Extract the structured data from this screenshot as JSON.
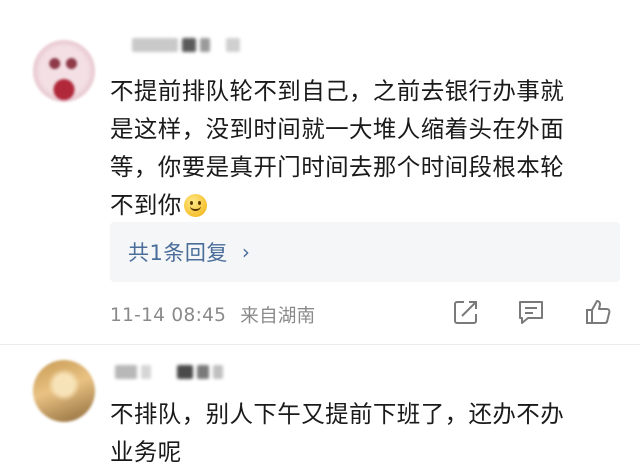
{
  "comments": [
    {
      "username": "",
      "text_lines": [
        "不提前排队轮不到自己，之前去银行办事就",
        "是这样，没到时间就一大堆人缩着头在外面",
        "等，你要是真开门时间去那个时间段根本轮",
        "不到你"
      ],
      "emoji_icon": "smile-emoji-icon",
      "reply_label": "共1条回复",
      "timestamp": "11-14 08:45",
      "location": "来自湖南"
    },
    {
      "username": "",
      "text_lines": [
        "不排队，别人下午又提前下班了，还办不办",
        "业务呢"
      ]
    }
  ],
  "colors": {
    "link": "#4a6d9a",
    "meta": "#8a8a8a",
    "reply_bg": "#f5f6f8"
  }
}
